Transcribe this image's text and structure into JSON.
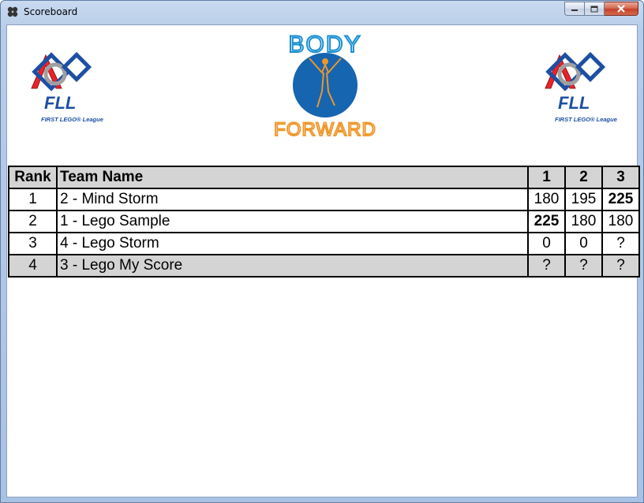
{
  "window": {
    "title": "Scoreboard"
  },
  "logos": {
    "left": {
      "wordmark": "FLL",
      "tagline": "FIRST LEGO® League"
    },
    "right": {
      "wordmark": "FLL",
      "tagline": "FIRST LEGO® League"
    },
    "center": {
      "top_text": "BODY",
      "bottom_text": "FORWARD"
    }
  },
  "table": {
    "headers": {
      "rank": "Rank",
      "team": "Team Name",
      "r1": "1",
      "r2": "2",
      "r3": "3"
    },
    "rows": [
      {
        "rank": "1",
        "team": "2 - Mind Storm",
        "r1": "180",
        "r2": "195",
        "r3": "225"
      },
      {
        "rank": "2",
        "team": "1 - Lego Sample",
        "r1": "225",
        "r2": "180",
        "r3": "180"
      },
      {
        "rank": "3",
        "team": "4 - Lego Storm",
        "r1": "0",
        "r2": "0",
        "r3": "?"
      },
      {
        "rank": "4",
        "team": "3 - Lego My Score",
        "r1": "?",
        "r2": "?",
        "r3": "?"
      }
    ]
  },
  "colors": {
    "fll_red": "#e8232b",
    "fll_blue": "#1d4fa3",
    "body_blue": "#1a8fd0",
    "forward_orange": "#f0962a"
  }
}
